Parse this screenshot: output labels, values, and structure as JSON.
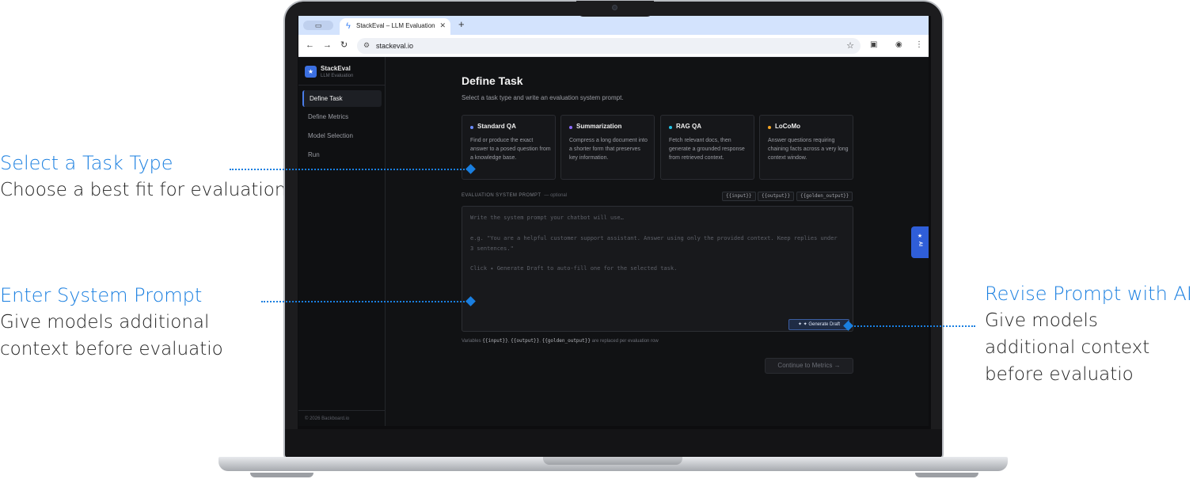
{
  "annotations": [
    {
      "title": "Select a Task Type",
      "desc": "Choose a best fit for evaluation"
    },
    {
      "title": "Enter System Prompt",
      "desc": "Give models additional context before evaluatio"
    },
    {
      "title": "Revise Prompt with AI",
      "desc": "Give models additional context before evaluatio"
    }
  ],
  "browser": {
    "tab_title": "StackEval – LLM Evaluation T",
    "url": "stackeval.io"
  },
  "app": {
    "brand_name": "StackEval",
    "brand_sub": "LLM Evaluation",
    "nav": [
      "Define Task",
      "Define Metrics",
      "Model Selection",
      "Run"
    ],
    "footer": "© 2026 Backboard.io",
    "page_title": "Define Task",
    "page_subtitle": "Select a task type and write an evaluation system prompt.",
    "tasks": [
      {
        "title": "Standard QA",
        "desc": "Find or produce the exact answer to a posed question from a knowledge base.",
        "color": "#6b8cff"
      },
      {
        "title": "Summarization",
        "desc": "Compress a long document into a shorter form that preserves key information.",
        "color": "#8b6bff"
      },
      {
        "title": "RAG QA",
        "desc": "Fetch relevant docs, then generate a grounded response from retrieved context.",
        "color": "#22c3e6"
      },
      {
        "title": "LoCoMo",
        "desc": "Answer questions requiring chaining facts across a very long context window.",
        "color": "#f5a524"
      }
    ],
    "prompt_label": "EVALUATION SYSTEM PROMPT",
    "prompt_optional": "— optional",
    "chips": [
      "{{input}}",
      "{{output}}",
      "{{golden_output}}"
    ],
    "prompt_placeholder_1": "Write the system prompt your chatbot will use…",
    "prompt_placeholder_2": "e.g. \"You are a helpful customer support assistant. Answer using only the provided context. Keep replies under 3 sentences.\"",
    "prompt_placeholder_3": "Click ✦ Generate Draft to auto-fill one for the selected task.",
    "generate_label": "✦ ✦ Generate Draft",
    "vars_prefix": "Variables",
    "var_1": "{{input}}",
    "var_2": "{{output}}",
    "var_3": "{{golden_output}}",
    "vars_suffix": "are replaced per evaluation row",
    "continue_label": "Continue to Metrics →",
    "ai_tab_label": "AI"
  }
}
